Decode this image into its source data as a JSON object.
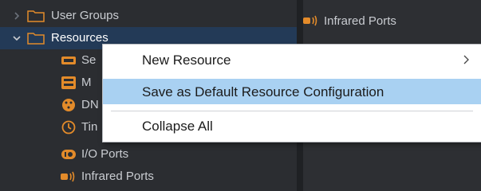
{
  "tree": {
    "items": [
      {
        "label": "User Groups"
      },
      {
        "label": "Resources"
      },
      {
        "label": "Se"
      },
      {
        "label": "M"
      },
      {
        "label": "DN"
      },
      {
        "label": "Tin"
      },
      {
        "label": "I/O Ports"
      },
      {
        "label": "Infrared Ports"
      }
    ]
  },
  "right_pane": {
    "item": {
      "label": "Infrared Ports"
    }
  },
  "context_menu": {
    "items": [
      {
        "label": "New Resource",
        "has_submenu": true
      },
      {
        "label": "Save as Default Resource Configuration",
        "highlighted": true
      },
      {
        "label": "Collapse All"
      }
    ]
  },
  "colors": {
    "tree_bg": "#2b2d31",
    "selected_row": "#233a57",
    "menu_highlight": "#a9d1f2",
    "accent_orange": "#e38b2a"
  }
}
